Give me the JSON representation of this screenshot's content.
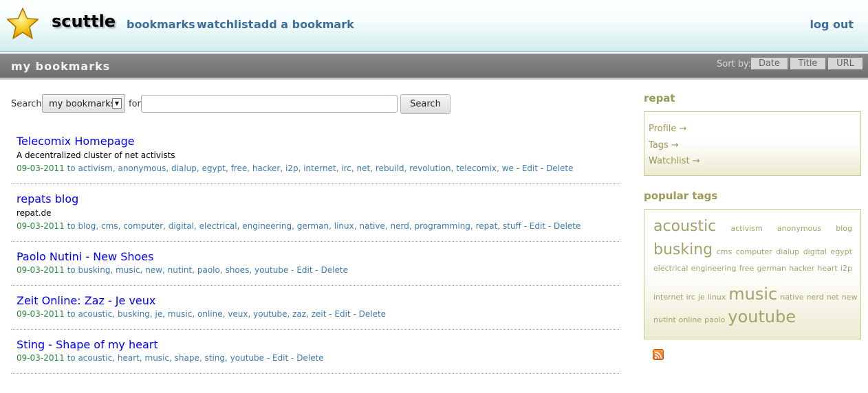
{
  "header": {
    "site_name": "scuttle",
    "nav": {
      "bookmarks": "bookmarks",
      "watchlist": "watchlist",
      "add": "add a bookmark",
      "logout": "log out"
    }
  },
  "titlebar": {
    "title": "my bookmarks",
    "sort_label": "Sort by:",
    "sort_date": "Date",
    "sort_title": "Title",
    "sort_url": "URL"
  },
  "search": {
    "label": "Search",
    "scope": "my bookmarks",
    "for_label": "for",
    "value": "",
    "button": "Search"
  },
  "bookmarks": [
    {
      "title": "Telecomix Homepage",
      "description": "A decentralized cluster of net activists",
      "date": "09-03-2011",
      "to": "to",
      "tags": [
        "activism",
        "anonymous",
        "dialup",
        "egypt",
        "free",
        "hacker",
        "i2p",
        "internet",
        "irc",
        "net",
        "rebuild",
        "revolution",
        "telecomix",
        "we"
      ],
      "edit": "Edit",
      "delete": "Delete"
    },
    {
      "title": "repats blog",
      "description": "repat.de",
      "date": "09-03-2011",
      "to": "to",
      "tags": [
        "blog",
        "cms",
        "computer",
        "digital",
        "electrical",
        "engineering",
        "german",
        "linux",
        "native",
        "nerd",
        "programming",
        "repat",
        "stuff"
      ],
      "edit": "Edit",
      "delete": "Delete"
    },
    {
      "title": "Paolo Nutini - New Shoes",
      "description": "",
      "date": "09-03-2011",
      "to": "to",
      "tags": [
        "busking",
        "music",
        "new",
        "nutint",
        "paolo",
        "shoes",
        "youtube"
      ],
      "edit": "Edit",
      "delete": "Delete"
    },
    {
      "title": "Zeit Online: Zaz - Je veux",
      "description": "",
      "date": "09-03-2011",
      "to": "to",
      "tags": [
        "acoustic",
        "busking",
        "je",
        "music",
        "online",
        "veux",
        "youtube",
        "zaz",
        "zeit"
      ],
      "edit": "Edit",
      "delete": "Delete"
    },
    {
      "title": "Sting - Shape of my heart",
      "description": "",
      "date": "09-03-2011",
      "to": "to",
      "tags": [
        "acoustic",
        "heart",
        "music",
        "shape",
        "sting",
        "youtube"
      ],
      "edit": "Edit",
      "delete": "Delete"
    }
  ],
  "sidebar": {
    "user_heading": "repat",
    "profile": "Profile →",
    "tags": "Tags →",
    "watchlist": "Watchlist →",
    "popular_heading": "popular tags",
    "cloud_lines": [
      [
        {
          "t": "acoustic",
          "s": 22
        },
        {
          "t": "activism",
          "s": 11
        },
        {
          "t": "anonymous",
          "s": 11
        },
        {
          "t": "blog",
          "s": 11
        }
      ],
      [
        {
          "t": "busking",
          "s": 22
        },
        {
          "t": "cms",
          "s": 11
        },
        {
          "t": "computer",
          "s": 11
        },
        {
          "t": "dialup",
          "s": 11
        },
        {
          "t": "digital",
          "s": 11
        },
        {
          "t": "egypt",
          "s": 11
        }
      ],
      [
        {
          "t": "electrical",
          "s": 11
        },
        {
          "t": "engineering",
          "s": 11
        },
        {
          "t": "free",
          "s": 11
        },
        {
          "t": "german",
          "s": 11
        },
        {
          "t": "hacker",
          "s": 11
        },
        {
          "t": "heart",
          "s": 11
        },
        {
          "t": "i2p",
          "s": 11
        }
      ],
      [
        {
          "t": "internet",
          "s": 11
        },
        {
          "t": "irc",
          "s": 11
        },
        {
          "t": "je",
          "s": 11
        },
        {
          "t": "linux",
          "s": 11
        },
        {
          "t": "music",
          "s": 24
        },
        {
          "t": "native",
          "s": 11
        },
        {
          "t": "nerd",
          "s": 11
        },
        {
          "t": "net",
          "s": 11
        },
        {
          "t": "new",
          "s": 11
        }
      ],
      [
        {
          "t": "nutint",
          "s": 11
        },
        {
          "t": "online",
          "s": 11
        },
        {
          "t": "paolo",
          "s": 11
        },
        {
          "t": "youtube",
          "s": 24
        }
      ]
    ]
  },
  "icons": {
    "logo": "star-logo-icon",
    "rss": "rss-feed-icon"
  },
  "colors": {
    "link_blue": "#0000ff",
    "tag_blue": "#3d7bb0",
    "date_green": "#2e8b3e",
    "olive": "#9a9a54"
  }
}
